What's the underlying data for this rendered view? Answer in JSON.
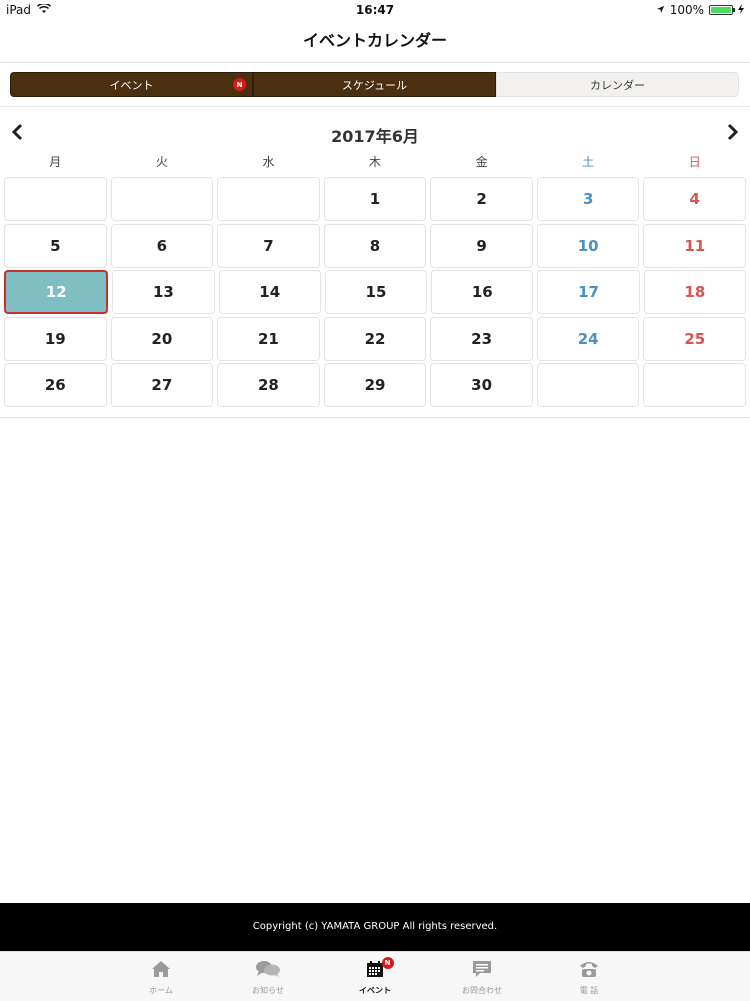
{
  "status_bar": {
    "device": "iPad",
    "time": "16:47",
    "battery_text": "100%",
    "battery_level": 1.0,
    "battery_color": "#4cd964"
  },
  "nav": {
    "title": "イベントカレンダー"
  },
  "segment": {
    "items": [
      {
        "label": "イベント",
        "badge": "N"
      },
      {
        "label": "スケジュール"
      },
      {
        "label": "カレンダー"
      }
    ],
    "dark_color": "#4a3010",
    "light_color": "#f2f1ef"
  },
  "calendar": {
    "month_title": "2017年6月",
    "weekdays": [
      "月",
      "火",
      "水",
      "木",
      "金",
      "土",
      "日"
    ],
    "weeks": [
      [
        "",
        "",
        "",
        "1",
        "2",
        "3",
        "4"
      ],
      [
        "5",
        "6",
        "7",
        "8",
        "9",
        "10",
        "11"
      ],
      [
        "12",
        "13",
        "14",
        "15",
        "16",
        "17",
        "18"
      ],
      [
        "19",
        "20",
        "21",
        "22",
        "23",
        "24",
        "25"
      ],
      [
        "26",
        "27",
        "28",
        "29",
        "30",
        "",
        ""
      ]
    ],
    "selected_day": "12",
    "selected_bg": "#7fbfc3",
    "saturday_color": "#4a90c6",
    "sunday_color": "#d9534f"
  },
  "footer": {
    "copyright": "Copyright (c) YAMATA GROUP All rights reserved."
  },
  "tabbar": {
    "items": [
      {
        "label": "ホーム",
        "icon": "home-icon"
      },
      {
        "label": "お知らせ",
        "icon": "chat-icon"
      },
      {
        "label": "イベント",
        "icon": "calendar-icon",
        "badge": "N",
        "active": true
      },
      {
        "label": "お問合わせ",
        "icon": "message-icon"
      },
      {
        "label": "電 話",
        "icon": "phone-icon"
      }
    ]
  }
}
